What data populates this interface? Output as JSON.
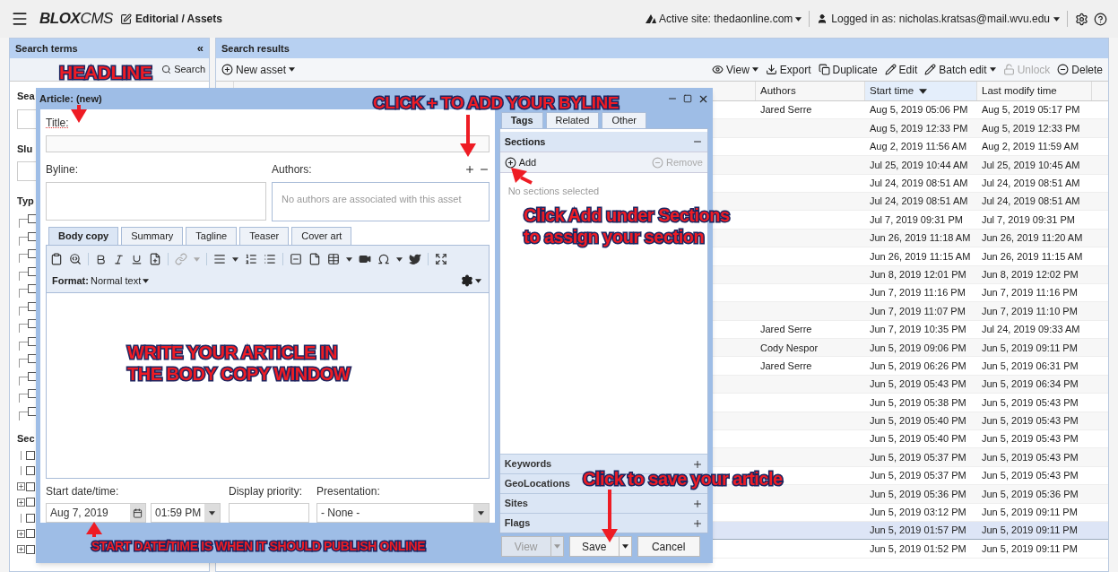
{
  "top_bar": {
    "logo": "**BLOX**CMS",
    "breadcrumb": "Editorial / Assets",
    "active_site": "Active site: thedaonline.com",
    "user": "Logged in as: nicholas.kratsas@mail.wvu.edu"
  },
  "search_terms": {
    "title": "Search terms",
    "collapse": "«",
    "search_button": "Search",
    "fields": [
      "Sea",
      "Slu"
    ],
    "type_label": "Typ",
    "type_items": [
      {
        "checked": false
      },
      {
        "checked": false
      },
      {
        "checked": false
      },
      {
        "checked": false
      },
      {
        "checked": false
      },
      {
        "checked": false
      },
      {
        "checked": false
      },
      {
        "checked": false
      },
      {
        "checked": false
      },
      {
        "checked": false
      },
      {
        "checked": false
      },
      {
        "checked": false
      }
    ],
    "section_label": "Sec",
    "section_items": [
      {
        "checked": false,
        "expandable": false
      },
      {
        "checked": false,
        "expandable": false
      },
      {
        "checked": false,
        "expandable": true
      },
      {
        "checked": false,
        "expandable": true
      },
      {
        "checked": false,
        "expandable": false
      },
      {
        "checked": false,
        "expandable": true
      },
      {
        "checked": false,
        "expandable": true
      }
    ]
  },
  "search_results": {
    "title": "Search results",
    "new_asset": "New asset",
    "actions": [
      {
        "kind": "view",
        "label": "View",
        "menu": true,
        "disabled": false
      },
      {
        "kind": "export",
        "label": "Export",
        "menu": false,
        "disabled": false
      },
      {
        "kind": "duplicate",
        "label": "Duplicate",
        "menu": false,
        "disabled": false
      },
      {
        "kind": "edit",
        "label": "Edit",
        "menu": false,
        "disabled": false
      },
      {
        "kind": "batch_edit",
        "label": "Batch edit",
        "menu": true,
        "disabled": false
      },
      {
        "kind": "unlock",
        "label": "Unlock",
        "menu": false,
        "disabled": true
      },
      {
        "kind": "delete",
        "label": "Delete",
        "menu": false,
        "disabled": false
      }
    ],
    "columns": [
      {
        "label": "Authors",
        "sorted": false
      },
      {
        "label": "Start time",
        "sorted": true
      },
      {
        "label": "Last modify time",
        "sorted": false
      }
    ],
    "rows": [
      {
        "author": "Jared Serre",
        "start": "Aug 5, 2019 05:06 PM",
        "modified": "Aug 5, 2019 05:17 PM",
        "selected": false
      },
      {
        "start": "Aug 5, 2019 12:33 PM",
        "modified": "Aug 5, 2019 12:33 PM",
        "selected": false
      },
      {
        "start": "Aug 2, 2019 11:56 AM",
        "modified": "Aug 2, 2019 11:59 AM",
        "selected": false
      },
      {
        "start": "Jul 25, 2019 10:44 AM",
        "modified": "Jul 25, 2019 10:45 AM",
        "selected": false
      },
      {
        "start": "Jul 24, 2019 08:51 AM",
        "modified": "Jul 24, 2019 08:51 AM",
        "selected": false
      },
      {
        "start": "Jul 24, 2019 08:51 AM",
        "modified": "Jul 24, 2019 08:51 AM",
        "selected": false
      },
      {
        "start": "Jul 7, 2019 09:31 PM",
        "modified": "Jul 7, 2019 09:31 PM",
        "selected": false
      },
      {
        "start": "Jun 26, 2019 11:18 AM",
        "modified": "Jun 26, 2019 11:20 AM",
        "selected": false
      },
      {
        "start": "Jun 26, 2019 11:15 AM",
        "modified": "Jun 26, 2019 11:15 AM",
        "selected": false
      },
      {
        "start": "Jun 8, 2019 12:01 PM",
        "modified": "Jun 8, 2019 12:02 PM",
        "selected": false
      },
      {
        "start": "Jun 7, 2019 11:16 PM",
        "modified": "Jun 7, 2019 11:16 PM",
        "selected": false
      },
      {
        "start": "Jun 7, 2019 11:07 PM",
        "modified": "Jun 7, 2019 11:10 PM",
        "selected": false
      },
      {
        "author": "Jared Serre",
        "start": "Jun 7, 2019 10:35 PM",
        "modified": "Jul 24, 2019 09:33 AM",
        "selected": false
      },
      {
        "author": "Cody Nespor",
        "start": "Jun 5, 2019 09:06 PM",
        "modified": "Jun 5, 2019 09:11 PM",
        "selected": false
      },
      {
        "author": "Jared Serre",
        "start": "Jun 5, 2019 06:26 PM",
        "modified": "Jun 5, 2019 06:31 PM",
        "selected": false
      },
      {
        "start": "Jun 5, 2019 05:43 PM",
        "modified": "Jun 5, 2019 06:34 PM",
        "selected": false
      },
      {
        "start": "Jun 5, 2019 05:38 PM",
        "modified": "Jun 5, 2019 05:43 PM",
        "selected": false
      },
      {
        "start": "Jun 5, 2019 05:40 PM",
        "modified": "Jun 5, 2019 05:43 PM",
        "selected": false
      },
      {
        "start": "Jun 5, 2019 05:40 PM",
        "modified": "Jun 5, 2019 05:43 PM",
        "selected": false
      },
      {
        "start": "Jun 5, 2019 05:37 PM",
        "modified": "Jun 5, 2019 05:43 PM",
        "selected": false
      },
      {
        "start": "Jun 5, 2019 05:37 PM",
        "modified": "Jun 5, 2019 05:43 PM",
        "selected": false
      },
      {
        "start": "Jun 5, 2019 05:36 PM",
        "modified": "Jun 5, 2019 05:36 PM",
        "selected": false
      },
      {
        "start": "Jun 5, 2019 03:12 PM",
        "modified": "Jun 5, 2019 09:11 PM",
        "selected": false
      },
      {
        "start": "Jun 5, 2019 01:57 PM",
        "modified": "Jun 5, 2019 09:11 PM",
        "selected": true
      },
      {
        "start": "Jun 5, 2019 01:52 PM",
        "modified": "Jun 5, 2019 09:11 PM",
        "selected": false
      }
    ]
  },
  "dialog": {
    "title": "Article: (new)",
    "title_label": "Title:",
    "byline_label": "Byline:",
    "authors_label": "Authors:",
    "authors_empty": "No authors are associated with this asset",
    "editor_tabs": [
      {
        "label": "Body copy",
        "selected": true
      },
      {
        "label": "Summary",
        "selected": false
      },
      {
        "label": "Tagline",
        "selected": false
      },
      {
        "label": "Teaser",
        "selected": false
      },
      {
        "label": "Cover art",
        "selected": false
      }
    ],
    "format_label": "Format:",
    "format_value": "Normal text",
    "start_label": "Start date/time:",
    "start_date": "Aug 7, 2019",
    "start_time": "01:59 PM",
    "priority_label": "Display priority:",
    "presentation_label": "Presentation:",
    "presentation_value": "- None -",
    "side_tabs": [
      {
        "label": "Tags",
        "selected": true
      },
      {
        "label": "Related",
        "selected": false
      },
      {
        "label": "Other",
        "selected": false
      }
    ],
    "sections": {
      "title": "Sections",
      "add": "Add",
      "remove": "Remove",
      "remove_disabled": true,
      "empty": "No sections selected"
    },
    "accordion": [
      {
        "label": "Keywords",
        "plus_shown": true
      },
      {
        "label": "GeoLocations",
        "plus_shown": false
      },
      {
        "label": "Sites",
        "plus_shown": true
      },
      {
        "label": "Flags",
        "plus_shown": true
      }
    ],
    "buttons": [
      {
        "label": "View",
        "disabled": true,
        "menu": true
      },
      {
        "label": "Save",
        "disabled": false,
        "menu": true
      },
      {
        "label": "Cancel",
        "disabled": false,
        "menu": false
      }
    ]
  },
  "annotations": [
    {
      "lines": [
        "HEADLINE"
      ]
    },
    {
      "lines": [
        "CLICK + TO ADD YOUR BYLINE"
      ]
    },
    {
      "lines": [
        "Click Add under Sections",
        "to assign your section"
      ]
    },
    {
      "lines": [
        "WRITE YOUR ARTICLE IN",
        "THE BODY COPY WINDOW"
      ]
    },
    {
      "lines": [
        "Click to save your article"
      ]
    },
    {
      "lines": [
        "START DATE/TIME IS WHEN IT SHOULD PUBLISH ONLINE"
      ]
    }
  ]
}
